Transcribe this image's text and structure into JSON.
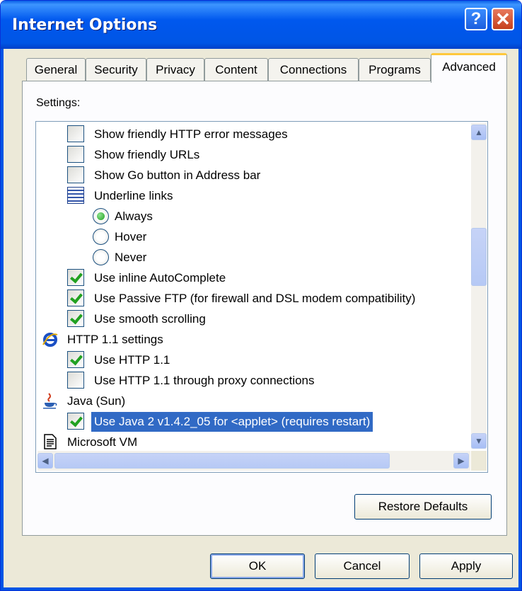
{
  "window": {
    "title": "Internet Options",
    "help_label": "?",
    "close_label": "✕"
  },
  "tabs": [
    "General",
    "Security",
    "Privacy",
    "Content",
    "Connections",
    "Programs",
    "Advanced"
  ],
  "active_tab": "Advanced",
  "settings_label": "Settings:",
  "settings": [
    {
      "type": "checkbox",
      "checked": false,
      "label": "Show friendly HTTP error messages"
    },
    {
      "type": "checkbox",
      "checked": false,
      "label": "Show friendly URLs"
    },
    {
      "type": "checkbox",
      "checked": false,
      "label": "Show Go button in Address bar"
    },
    {
      "type": "group",
      "icon": "list-icon",
      "label": "Underline links"
    },
    {
      "type": "radio",
      "selected": true,
      "label": "Always"
    },
    {
      "type": "radio",
      "selected": false,
      "label": "Hover"
    },
    {
      "type": "radio",
      "selected": false,
      "label": "Never"
    },
    {
      "type": "checkbox",
      "checked": true,
      "label": "Use inline AutoComplete"
    },
    {
      "type": "checkbox",
      "checked": true,
      "label": "Use Passive FTP (for firewall and DSL modem compatibility)"
    },
    {
      "type": "checkbox",
      "checked": true,
      "label": "Use smooth scrolling"
    },
    {
      "type": "group",
      "icon": "ie-icon",
      "label": "HTTP 1.1 settings"
    },
    {
      "type": "checkbox",
      "checked": true,
      "label": "Use HTTP 1.1"
    },
    {
      "type": "checkbox",
      "checked": false,
      "label": "Use HTTP 1.1 through proxy connections"
    },
    {
      "type": "group",
      "icon": "java-icon",
      "label": "Java (Sun)"
    },
    {
      "type": "checkbox",
      "checked": true,
      "selected": true,
      "label": "Use Java 2 v1.4.2_05 for <applet> (requires restart)"
    },
    {
      "type": "group",
      "icon": "document-icon",
      "label": "Microsoft VM"
    }
  ],
  "buttons": {
    "restore": "Restore Defaults",
    "ok": "OK",
    "cancel": "Cancel",
    "apply": "Apply"
  },
  "colors": {
    "titlebar": "#0055e5",
    "selection": "#316ac5",
    "check": "#21a121"
  }
}
